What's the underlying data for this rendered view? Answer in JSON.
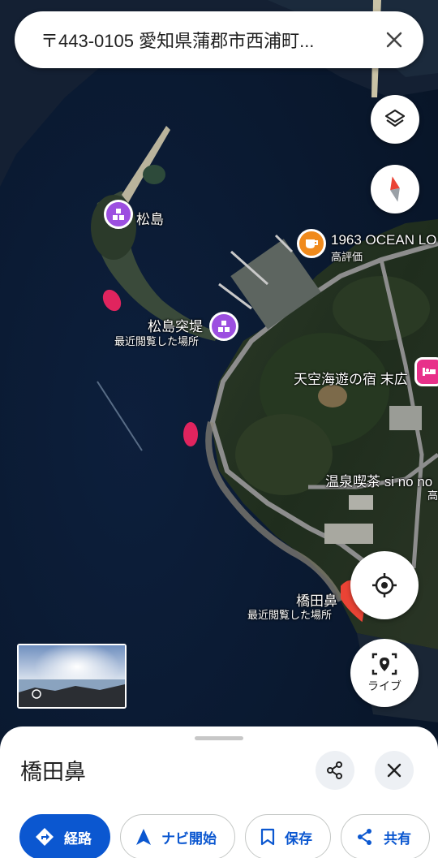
{
  "search": {
    "query": "〒443-0105 愛知県蒲郡市西浦町..."
  },
  "map": {
    "places": [
      {
        "name": "松島",
        "sub": ""
      },
      {
        "name": "松島突堤",
        "sub": "最近閲覧した場所"
      },
      {
        "name": "1963 OCEAN LO",
        "sub": "高評価"
      },
      {
        "name": "天空海遊の宿 末広",
        "sub": ""
      },
      {
        "name": "温泉喫茶 si no no",
        "sub": "高"
      },
      {
        "name": "橋田鼻",
        "sub": "最近閲覧した場所"
      }
    ]
  },
  "controls": {
    "live_label": "ライブ"
  },
  "sheet": {
    "title": "橋田鼻",
    "actions": [
      {
        "label": "経路",
        "icon": "directions-icon"
      },
      {
        "label": "ナビ開始",
        "icon": "navigation-arrow-icon"
      },
      {
        "label": "保存",
        "icon": "bookmark-icon"
      },
      {
        "label": "共有",
        "icon": "share-icon"
      }
    ]
  },
  "colors": {
    "accent": "#0b57d0",
    "pin_purple": "#9c4fe0",
    "pin_orange": "#f08a1c",
    "pin_pink": "#e8318a",
    "marker_red": "#ea4335"
  }
}
